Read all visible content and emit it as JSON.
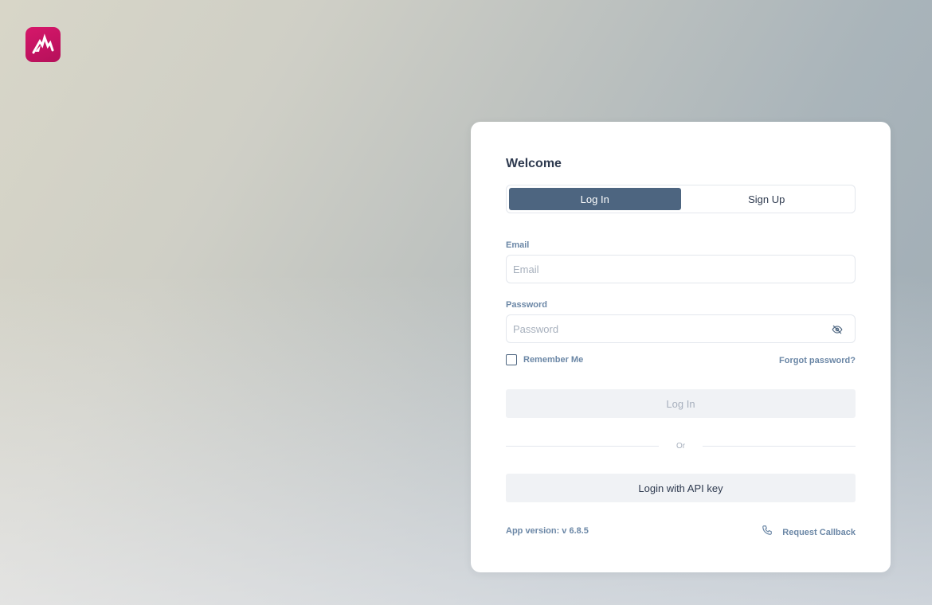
{
  "brand": {
    "logo_icon": "mountain-peak-logo",
    "color": "#c8135f"
  },
  "login_card": {
    "title": "Welcome",
    "tabs": [
      {
        "label": "Log In",
        "active": true
      },
      {
        "label": "Sign Up",
        "active": false
      }
    ],
    "email": {
      "label": "Email",
      "placeholder": "Email",
      "value": ""
    },
    "password": {
      "label": "Password",
      "placeholder": "Password",
      "value": "",
      "toggle_icon": "eye-off-icon"
    },
    "remember_me": {
      "label": "Remember Me",
      "checked": false
    },
    "forgot_password": "Forgot password?",
    "login_button": "Log In",
    "divider_text": "Or",
    "api_key_button": "Login with API key",
    "app_version": "App version: v 6.8.5",
    "request_callback": {
      "label": "Request Callback",
      "icon": "phone-icon"
    }
  },
  "colors": {
    "accent": "#4d6580",
    "label": "#6b87a6",
    "brand": "#c8135f"
  }
}
